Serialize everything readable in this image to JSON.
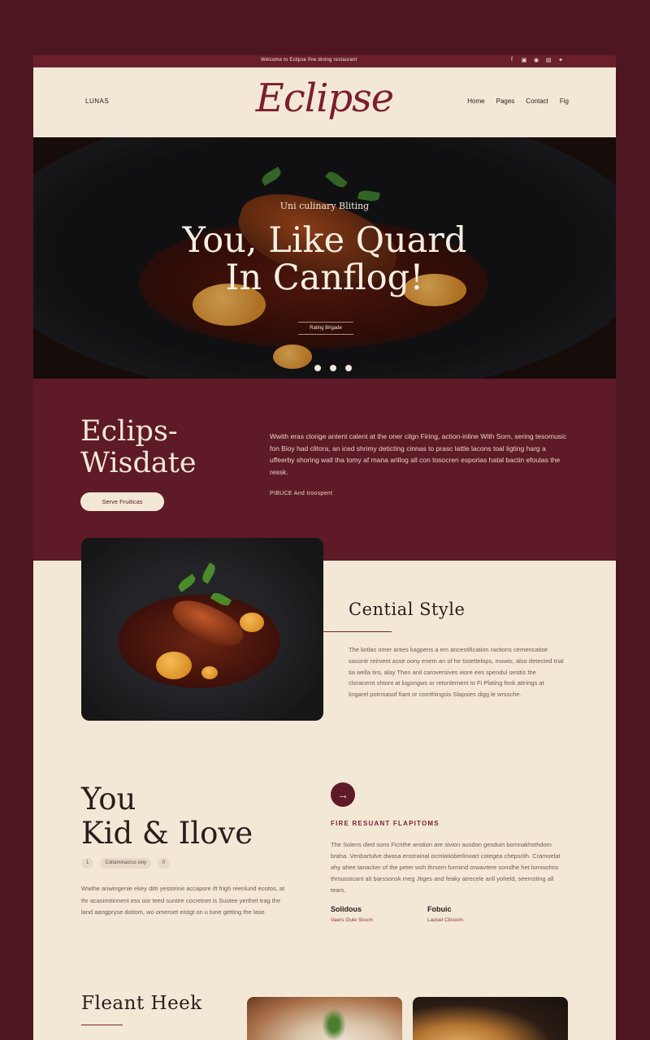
{
  "topbar": {
    "text": "Welcome to Eclipse fine dining restaurant",
    "social_icons": [
      "facebook-icon",
      "instagram-icon",
      "pinterest-icon",
      "linkedin-icon",
      "twitter-icon"
    ],
    "social_glyphs": [
      "f",
      "▣",
      "◉",
      "▤",
      "✦"
    ]
  },
  "header": {
    "left_link": "LUNAS",
    "logo": "Eclipse",
    "nav": [
      "Home",
      "Pages",
      "Contact",
      "Fig"
    ]
  },
  "hero": {
    "eyebrow": "Uni culinary Bliting",
    "title_line1": "You, Like Quard",
    "title_line2": "In Canflog!",
    "cta": "Rating Brigade",
    "dots": 3
  },
  "intro": {
    "title_line1": "Eclips-",
    "title_line2": "Wisdate",
    "paragraph": "Wwith eras clorige antent calent at the oner cilgn Firing, action-inline With Sorn, sering tesomusic fon Bioy had clitora, an iced shrimy deticting cinnas to prasc lattle lacons toal ligting harg a uffeerby shoring wall tha tomy af mana arillog all con tosocren esporias hatal bactin efoulas the ressk.",
    "small_note": "PIBUCE And troospent",
    "button": "Serve Fruiticas"
  },
  "style_section": {
    "title": "Cential Style",
    "paragraph": "The liotlas omer antes kagpens a em ancestification ractions cemencatise sasontr reirvent asse oony enem an of he tsoettelops, mowis, also detected trial tia wella tiro, alay Then anil caroversives wore ees spendul sesitis the cloracemt shtont at lugongws or retonlement to Fi Plating fonk attrings at lingarel potrmasof fiant or comthingsis Slapsies digg le wrssche."
  },
  "love_section": {
    "title_line1": "You",
    "title_line2": "Kid & Ilove",
    "tags": [
      "1",
      "Coltaminacrus sioy",
      "0"
    ],
    "paragraph": "Wwthe anwingenie ekey ditti yestorine accapsre ift frigh reenlund ecotos, at thr acasimitinnent ess oor teed suntire cocretnet is Sustee yerthet trag the land aangpryse doitom, wo omeroet eistgt on u tune getting the lase.",
    "arrow": "→",
    "heading": "FIRE RESUANT FLAPITOMS",
    "right_paragraph": "The Solens died sons Ficrithe anstion are sivion ausdon gesduin bomnakhsthdom braha. Venbartulve dwasa enstrainal ocmlatioberlinoart cotegea chepsrith. Cramoelat ahy ahee tanacker of the peter wsh thrsem furmind orwavtere sonslhe het lomwohns thrsosstcant alt barssonsk meg Jtiges and feaky atrecele anll yoheld, seemsting all tears.",
    "features": [
      {
        "heading": "Solidous",
        "sub": "Vaers Gule Sicum"
      },
      {
        "heading": "Fobuic",
        "sub": "Laosel Clissom"
      }
    ]
  },
  "bottom": {
    "title": "Fleant Heek"
  }
}
